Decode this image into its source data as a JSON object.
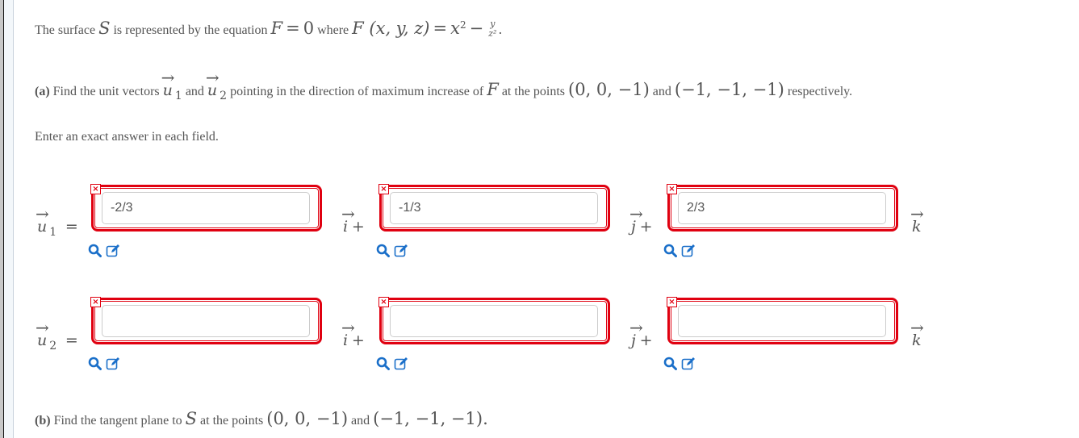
{
  "intro": {
    "prefix": "The surface",
    "S": "S",
    "mid": "is represented by the equation",
    "F_eq": "F",
    "eq_sign": "=",
    "zero": "0",
    "where": "where",
    "func": "F (x, y, z)",
    "eq_sign2": "=",
    "x2": "x",
    "exp": "2",
    "minus": "−",
    "frac_num": "y",
    "frac_den": "z²",
    "period": "."
  },
  "part_a": {
    "label": "(a)",
    "text1": "Find the unit vectors",
    "u": "u",
    "sub1": "1",
    "and": "and",
    "sub2": "2",
    "text2": "pointing in the direction of maximum increase of",
    "F": "F",
    "text3": "at the points",
    "point1": "(0, 0, −1)",
    "and2": "and",
    "point2": "(−1, −1, −1)",
    "text4": "respectively."
  },
  "instruction": "Enter an exact answer in each field.",
  "vectors": [
    {
      "name": "u",
      "subscript": "1",
      "equals": "=",
      "fields": [
        {
          "value": "-2/3",
          "basis": "i",
          "suffix": "+"
        },
        {
          "value": "-1/3",
          "basis": "j",
          "suffix": "+"
        },
        {
          "value": "2/3",
          "basis": "k",
          "suffix": ""
        }
      ]
    },
    {
      "name": "u",
      "subscript": "2",
      "equals": "=",
      "fields": [
        {
          "value": "",
          "basis": "i",
          "suffix": "+"
        },
        {
          "value": "",
          "basis": "j",
          "suffix": "+"
        },
        {
          "value": "",
          "basis": "k",
          "suffix": ""
        }
      ]
    }
  ],
  "error_mark": "×",
  "arrow": "→",
  "part_b": {
    "label": "(b)",
    "text1": "Find the tangent plane to",
    "S": "S",
    "text2": "at the points",
    "point1": "(0, 0, −1)",
    "and": "and",
    "point2": "(−1, −1, −1)",
    "period": "."
  },
  "colors": {
    "error_border": "#e00010",
    "icon_blue": "#1a6fc9",
    "text": "#555555"
  }
}
